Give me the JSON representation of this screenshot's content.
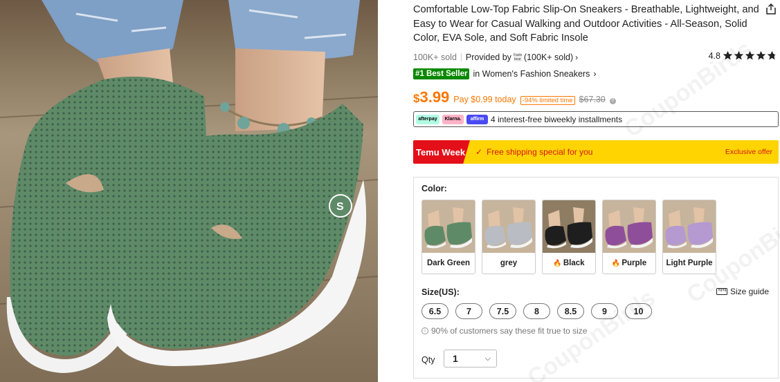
{
  "product": {
    "title": "Comfortable Low-Top Fabric Slip-On Sneakers - Breathable, Lightweight, and Easy to Wear for Casual Walking and Outdoor Activities - All-Season, Solid Color, EVA Sole, and Soft Fabric Insole",
    "share_icon": "share-icon",
    "sold": "100K+ sold",
    "provided_by": "Provided by",
    "store_logo_text": "Faste bear",
    "store_sold": "(100K+ sold)",
    "rating_value": "4.8",
    "rating_stars": 4.8,
    "best_seller_badge": "#1 Best Seller",
    "best_seller_category": "in Women's Fashion Sneakers"
  },
  "price": {
    "currency": "$",
    "amount": "3.99",
    "pay_today": "Pay $0.99 today",
    "limited": "-94% limited time",
    "original": "$67.30"
  },
  "bnpl": {
    "providers": [
      "afterpay",
      "Klarna.",
      "affirm"
    ],
    "text": "4 interest-free biweekly installments"
  },
  "promo": {
    "label": "Temu Week",
    "free_shipping": "Free shipping special for you",
    "exclusive": "Exclusive offer",
    "colors": {
      "bg": "#ffd400",
      "label_bg": "#e3101a",
      "text": "#d31619"
    }
  },
  "options": {
    "color_label": "Color:",
    "colors": [
      {
        "name": "Dark Green",
        "hot": false,
        "shoe": "#5f8a68",
        "bg": "#c7b49c"
      },
      {
        "name": "grey",
        "hot": false,
        "shoe": "#b9bcc2",
        "bg": "#c7b49c"
      },
      {
        "name": "Black",
        "hot": true,
        "shoe": "#1e1e1e",
        "bg": "#8e7c63"
      },
      {
        "name": "Purple",
        "hot": true,
        "shoe": "#8f4e9a",
        "bg": "#c7b49c"
      },
      {
        "name": "Light Purple",
        "hot": false,
        "shoe": "#b49ad0",
        "bg": "#c7b49c"
      }
    ],
    "size_label": "Size(US):",
    "size_guide": "Size guide",
    "sizes": [
      "6.5",
      "7",
      "7.5",
      "8",
      "8.5",
      "9",
      "10"
    ],
    "fit_note": "90% of customers say these fit true to size",
    "qty_label": "Qty",
    "qty_value": "1"
  },
  "watermark": "CouponBirds",
  "accent_color": "#fb7701"
}
